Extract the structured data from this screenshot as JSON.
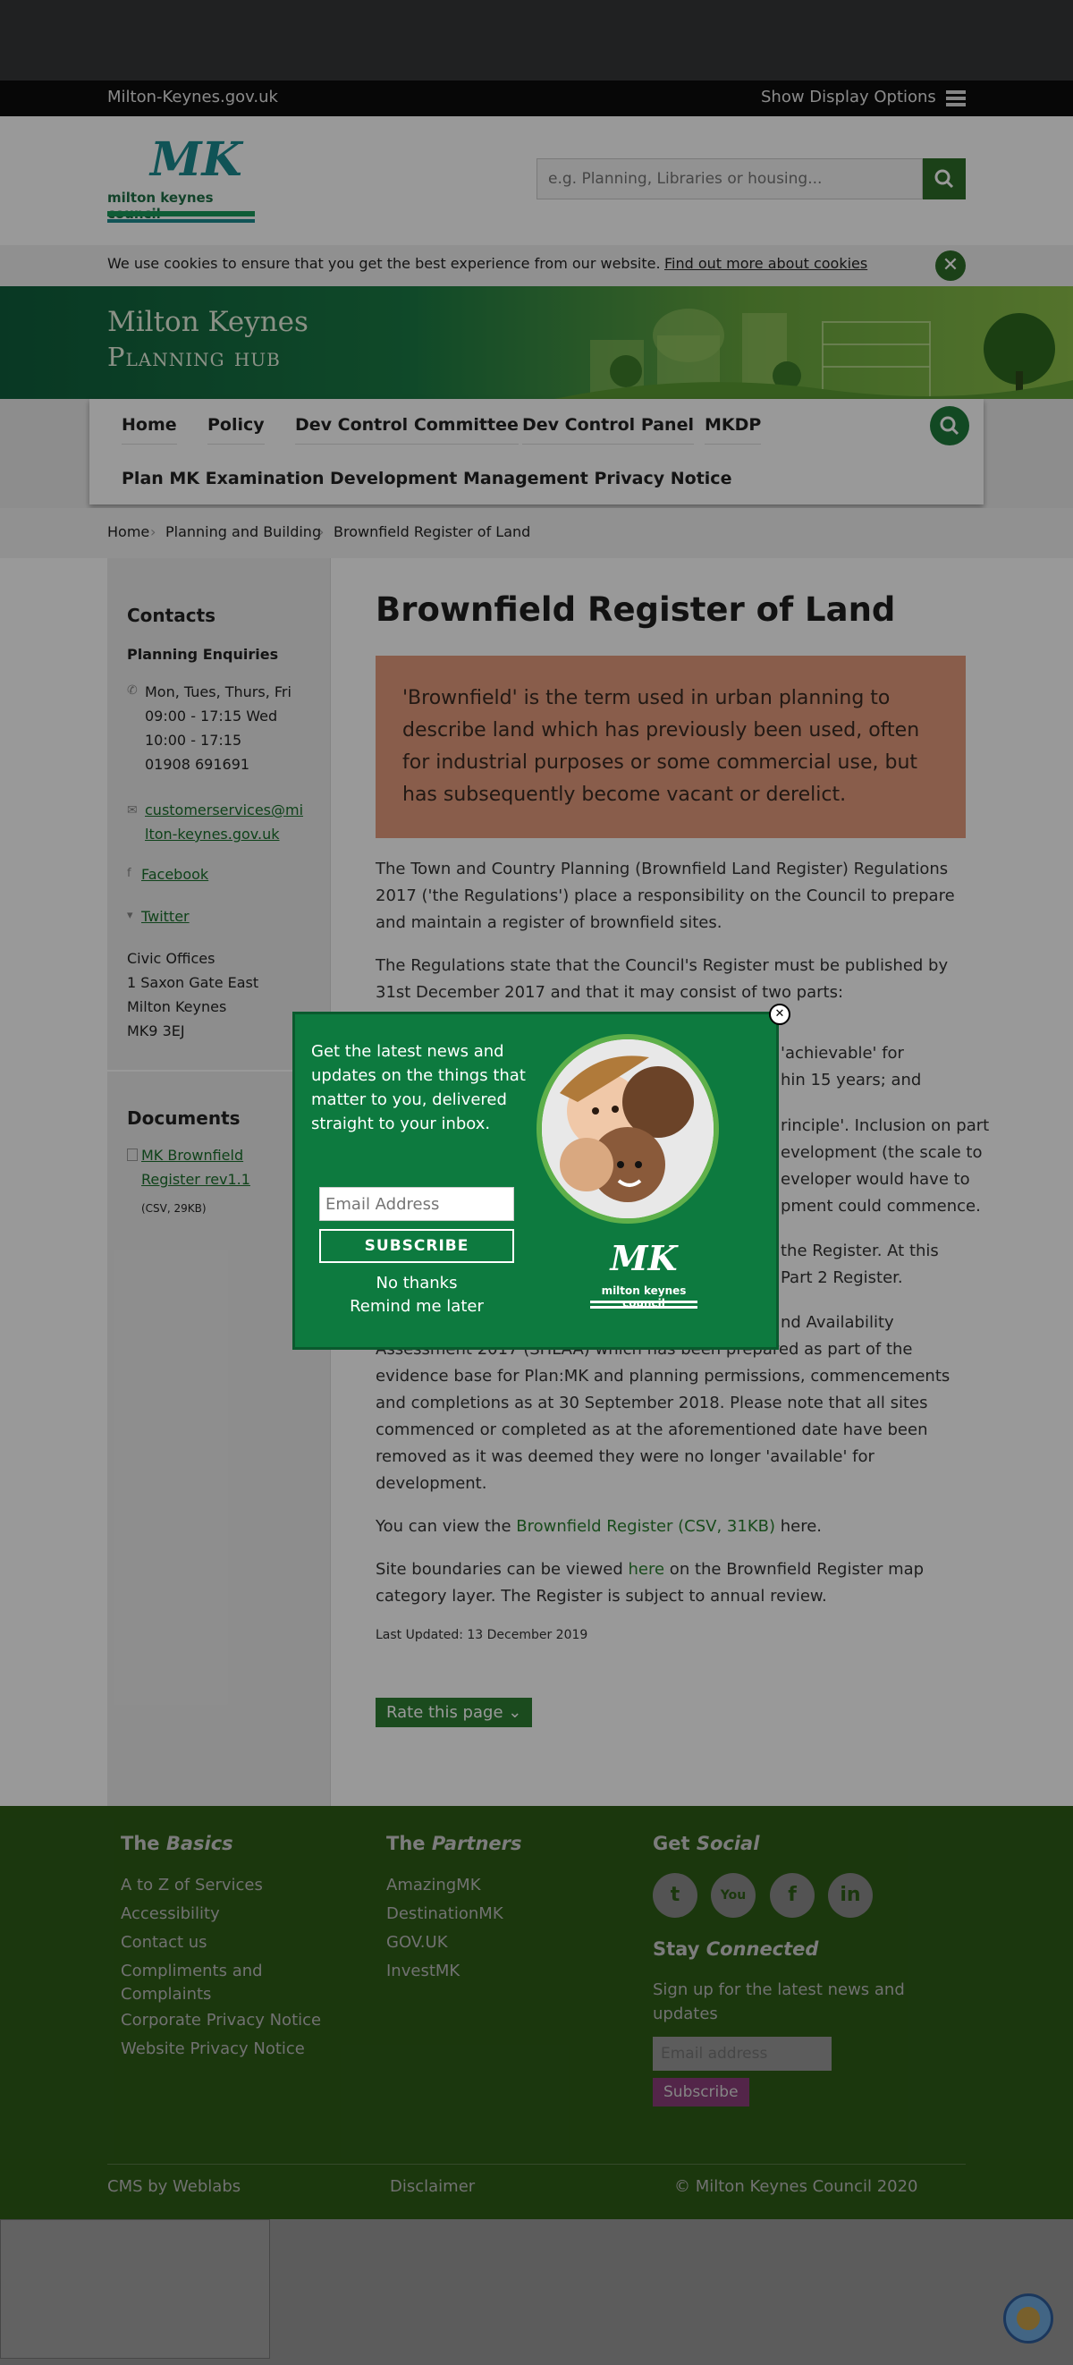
{
  "topbar": {
    "site": "Milton-Keynes.gov.uk",
    "display_options": "Show Display Options"
  },
  "header": {
    "logo_text": "milton keynes council",
    "logo_mark": "MK",
    "search_placeholder": "e.g. Planning, Libraries or housing..."
  },
  "cookie": {
    "text": "We use cookies to ensure that you get the best experience from our website.",
    "link": "Find out more about cookies"
  },
  "hero": {
    "line1": "Milton Keynes",
    "line2": "Planning hub"
  },
  "nav": {
    "items": [
      "Home",
      "Policy",
      "Dev Control Committee",
      "Dev Control Panel",
      "MKDP",
      "Plan MK Examination",
      "Development Management Privacy Notice"
    ]
  },
  "breadcrumb": {
    "items": [
      "Home",
      "Planning and Building",
      "Brownfield Register of Land"
    ]
  },
  "sidebar": {
    "contacts_title": "Contacts",
    "enquiries_title": "Planning Enquiries",
    "hours": [
      "Mon, Tues, Thurs, Fri",
      "09:00 - 17:15 Wed",
      "10:00 - 17:15",
      "01908 691691"
    ],
    "email": [
      "customerservices@mi",
      "lton-keynes.gov.uk"
    ],
    "facebook": "Facebook",
    "twitter": "Twitter",
    "address": [
      "Civic Offices",
      "1 Saxon Gate East",
      "Milton Keynes",
      "MK9 3EJ"
    ],
    "documents_title": "Documents",
    "doc_link": [
      "MK Brownfield",
      "Register rev1.1"
    ],
    "doc_meta": "(CSV, 29KB)"
  },
  "main": {
    "title": "Brownfield Register of Land",
    "callout": "'Brownfield' is the term used in urban planning to describe land which has previously been used, often for industrial purposes or some commercial use, but has subsequently become vacant or derelict.",
    "p1": "The Town and Country Planning (Brownfield Land Register) Regulations 2017 ('the Regulations') place a responsibility on the Council to prepare and maintain a register of brownfield sites.",
    "p2": "The Regulations state that the Council's Register must be published by 31st December 2017 and that it may consist of two parts:",
    "p3_frag1": "'achievable' for",
    "p3_frag2": "hin 15 years; and",
    "p4_frag1": "rinciple'. Inclusion on part",
    "p4_frag2": "evelopment (the scale to",
    "p4_frag3": "eveloper would have to",
    "p4_frag4": "pment could commence.",
    "p5_frag1": "the Register.  At this",
    "p5_frag2": "Part 2 Register.",
    "p6_frag1": "nd Availability",
    "p6_rest": "Assessment 2017 (SHLAA) which has been prepared as part of the evidence base for Plan:MK and planning permissions, commencements and completions as at 30 September 2018.  Please note that all sites commenced or completed as at the aforementioned date have been removed as it was deemed they were no longer 'available' for development.",
    "p7_pre": "You can view the ",
    "p7_link": "Brownfield Register (CSV, 31KB)",
    "p7_post": " here.",
    "p8_pre": "Site boundaries can be viewed ",
    "p8_link": "here",
    "p8_post": " on the Brownfield Register map category layer.  The Register is subject to annual review.",
    "updated": "Last Updated: 13 December 2019",
    "rate": "Rate this page"
  },
  "popup": {
    "text": "Get the latest news and updates on the things that matter to you, delivered straight to your inbox.",
    "email_placeholder": "Email Address",
    "subscribe": "SUBSCRIBE",
    "no_thanks": "No thanks",
    "remind": "Remind me later",
    "logo_mark": "MK",
    "logo_text": "milton keynes council"
  },
  "footer": {
    "basics_title_a": "The ",
    "basics_title_b": "Basics",
    "basics": [
      "A to Z of Services",
      "Accessibility",
      "Contact us",
      "Compliments and",
      "Complaints",
      "Corporate Privacy Notice",
      "Website Privacy Notice"
    ],
    "partners_title_a": "The ",
    "partners_title_b": "Partners",
    "partners": [
      "AmazingMK",
      "DestinationMK",
      "GOV.UK",
      "InvestMK"
    ],
    "social_title_a": "Get ",
    "social_title_b": "Social",
    "stay_title_a": "Stay ",
    "stay_title_b": "Connected",
    "stay_text": "Sign up for the latest news and updates",
    "email_placeholder": "Email address",
    "subscribe": "Subscribe",
    "cms": "CMS by Weblabs",
    "disclaimer": "Disclaimer",
    "copyright": "© Milton Keynes Council 2020"
  }
}
